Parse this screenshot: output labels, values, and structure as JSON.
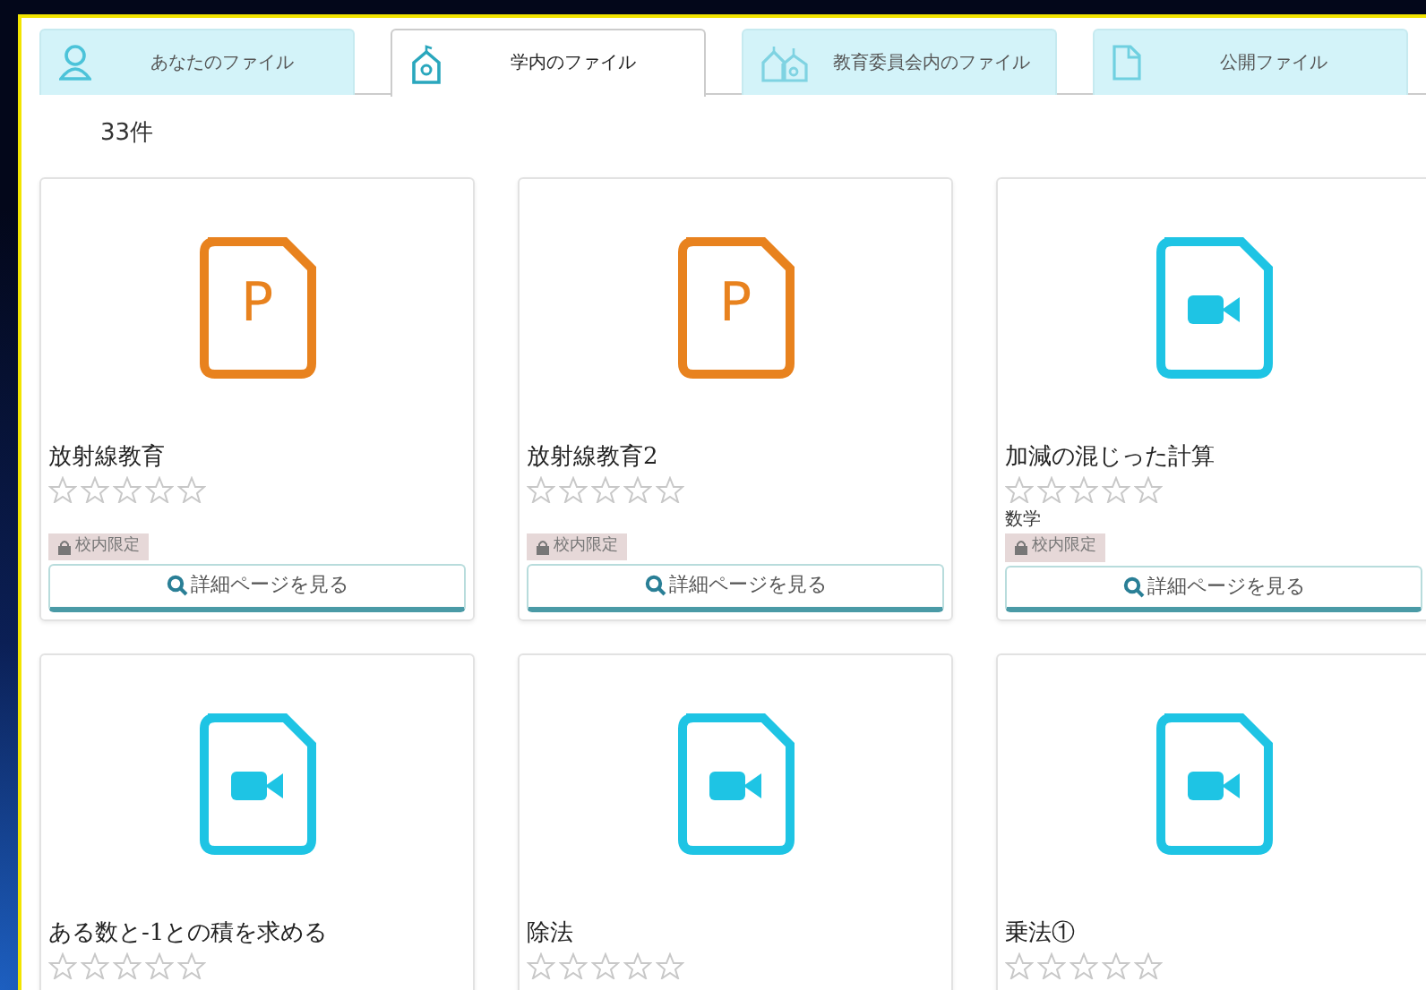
{
  "tabs": [
    {
      "label": "あなたのファイル",
      "kind": "person",
      "selected": false
    },
    {
      "label": "学内のファイル",
      "kind": "school",
      "selected": true
    },
    {
      "label": "教育委員会内のファイル",
      "kind": "houses",
      "selected": false
    },
    {
      "label": "公開ファイル",
      "kind": "document",
      "selected": false
    }
  ],
  "count": "33件",
  "files": [
    {
      "kind": "slides",
      "letter": "P",
      "title": "放射線教育",
      "stars": 0,
      "tag": "校内限定",
      "button": "詳細ページを見る"
    },
    {
      "kind": "slides",
      "letter": "P",
      "title": "放射線教育2",
      "stars": 0,
      "tag": "校内限定",
      "button": "詳細ページを見る"
    },
    {
      "kind": "video",
      "title": "加減の混じった計算",
      "stars": 0,
      "subject": "数学",
      "tag": "校内限定",
      "button": "詳細ページを見る"
    },
    {
      "kind": "video",
      "title": "ある数と-1との積を求める",
      "stars": 0
    },
    {
      "kind": "video",
      "title": "除法",
      "stars": 0
    },
    {
      "kind": "video",
      "title": "乗法①",
      "stars": 0
    }
  ]
}
